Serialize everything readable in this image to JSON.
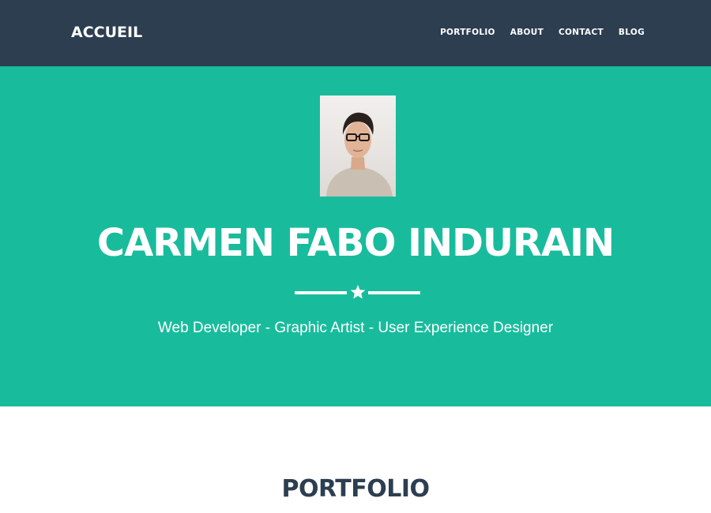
{
  "navbar": {
    "brand": "ACCUEIL",
    "links": [
      "PORTFOLIO",
      "ABOUT",
      "CONTACT",
      "BLOG"
    ]
  },
  "hero": {
    "name": "CARMEN FABO INDURAIN",
    "subtitle": "Web Developer - Graphic Artist - User Experience Designer",
    "divider_icon": "star-icon"
  },
  "portfolio": {
    "heading": "PORTFOLIO"
  },
  "colors": {
    "navbar_bg": "#2c3e50",
    "hero_bg": "#18bc9c",
    "text_light": "#ffffff",
    "heading_dark": "#2c3e50"
  }
}
